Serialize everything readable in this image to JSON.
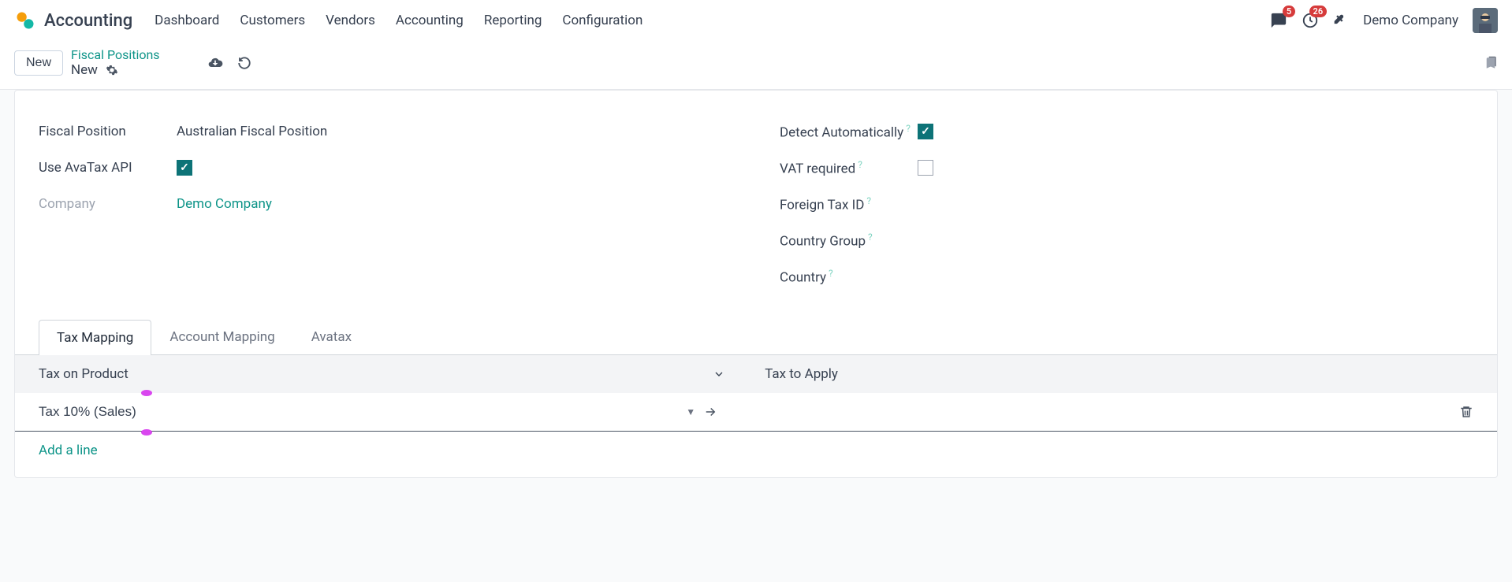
{
  "nav": {
    "app_title": "Accounting",
    "items": [
      "Dashboard",
      "Customers",
      "Vendors",
      "Accounting",
      "Reporting",
      "Configuration"
    ],
    "msg_badge": "5",
    "activity_badge": "26",
    "company": "Demo Company"
  },
  "breadcrumb": {
    "new_button": "New",
    "parent": "Fiscal Positions",
    "current": "New"
  },
  "form": {
    "left": {
      "fiscal_position_label": "Fiscal Position",
      "fiscal_position_value": "Australian Fiscal Position",
      "use_avatax_label": "Use AvaTax API",
      "use_avatax_checked": true,
      "company_label": "Company",
      "company_value": "Demo Company"
    },
    "right": {
      "detect_auto_label": "Detect Automatically",
      "detect_auto_checked": true,
      "vat_required_label": "VAT required",
      "vat_required_checked": false,
      "foreign_tax_label": "Foreign Tax ID",
      "country_group_label": "Country Group",
      "country_label": "Country"
    }
  },
  "tabs": {
    "items": [
      "Tax Mapping",
      "Account Mapping",
      "Avatax"
    ],
    "active": 0
  },
  "table": {
    "col_product": "Tax on Product",
    "col_apply": "Tax to Apply",
    "rows": [
      {
        "product": "Tax 10% (Sales)",
        "apply": ""
      }
    ],
    "add_line": "Add a line"
  }
}
